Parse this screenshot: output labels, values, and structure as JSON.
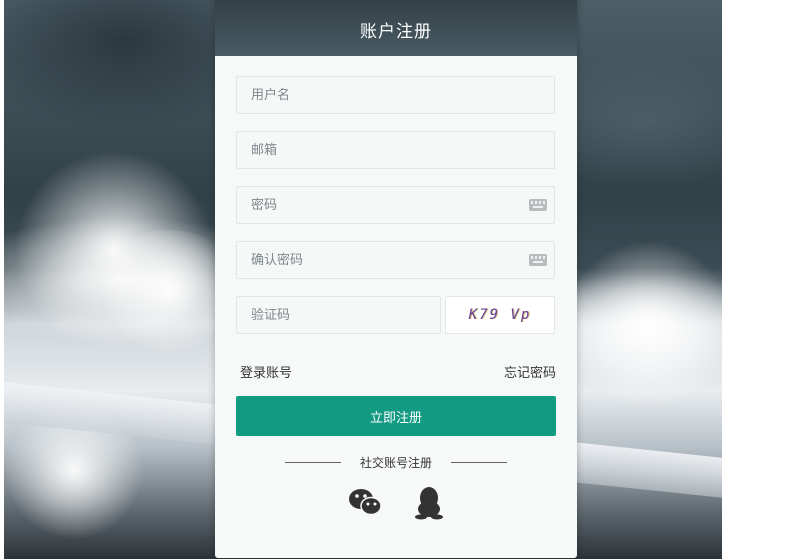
{
  "header": {
    "title": "账户注册"
  },
  "form": {
    "username_placeholder": "用户名",
    "email_placeholder": "邮箱",
    "password_placeholder": "密码",
    "confirm_password_placeholder": "确认密码",
    "captcha_placeholder": "验证码",
    "captcha_text": "K79 Vp"
  },
  "links": {
    "login": "登录账号",
    "forgot": "忘记密码"
  },
  "actions": {
    "register_label": "立即注册"
  },
  "social": {
    "heading": "社交账号注册",
    "icons": [
      "wechat-icon",
      "qq-icon"
    ]
  },
  "colors": {
    "accent": "#139a83",
    "header_bg": "#3d4d55"
  }
}
